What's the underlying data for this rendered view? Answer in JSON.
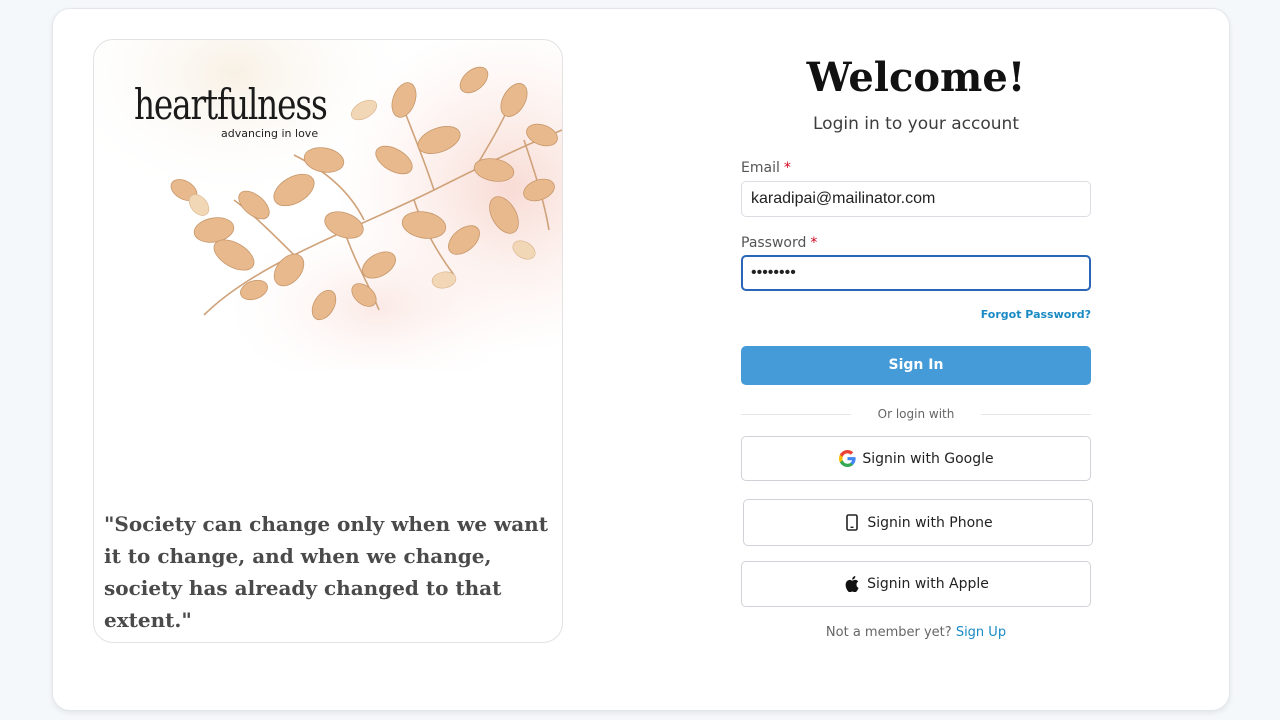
{
  "brand": {
    "logo_text": "heartfulness",
    "logo_tagline": "advancing in love",
    "quote": "\"Society can change only when we want it to change, and when we change, society has already changed to that extent.\""
  },
  "login": {
    "title": "Welcome!",
    "subtitle": "Login in to your account",
    "email_label": "Email",
    "email_value": "karadipai@mailinator.com",
    "password_label": "Password",
    "password_value": "••••••••",
    "required_mark": "*",
    "forgot_password": "Forgot Password?",
    "signin_label": "Sign In",
    "divider_text": "Or login with",
    "google_label": "Signin with Google",
    "phone_label": "Signin with Phone",
    "apple_label": "Signin with Apple",
    "footer_text": "Not a member yet?",
    "signup_link": "Sign Up"
  },
  "colors": {
    "primary_button": "#449bd8",
    "link": "#1a8ac4",
    "focus_border": "#2a66b7",
    "required": "#d0021b"
  },
  "icons": {
    "google": "google-icon",
    "phone": "phone-icon",
    "apple": "apple-icon"
  }
}
